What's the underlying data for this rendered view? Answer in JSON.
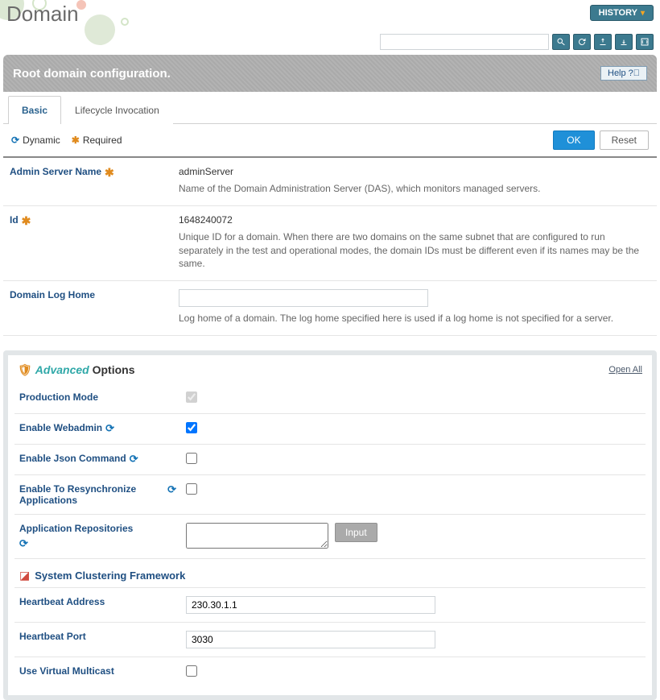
{
  "header": {
    "title": "Domain",
    "history_btn": "HISTORY",
    "search_placeholder": ""
  },
  "subtitle": "Root domain configuration.",
  "help_label": "Help",
  "tabs": {
    "basic": "Basic",
    "lifecycle": "Lifecycle Invocation"
  },
  "legend": {
    "dynamic": "Dynamic",
    "required": "Required"
  },
  "buttons": {
    "ok": "OK",
    "reset": "Reset",
    "input": "Input"
  },
  "rows": {
    "admin_server": {
      "label": "Admin Server Name",
      "value": "adminServer",
      "desc": "Name of the Domain Administration Server (DAS), which monitors managed servers."
    },
    "id": {
      "label": "Id",
      "value": "1648240072",
      "desc": "Unique ID for a domain. When there are two domains on the same subnet that are configured to run separately in the test and operational modes, the domain IDs must be different even if its names may be the same."
    },
    "log_home": {
      "label": "Domain Log Home",
      "value": "",
      "desc": "Log home of a domain. The log home specified here is used if a log home is not specified for a server."
    }
  },
  "advanced": {
    "title_prefix": "Advanced",
    "title_suffix": " Options",
    "open_all": "Open All",
    "production_mode": "Production Mode",
    "enable_webadmin": "Enable Webadmin",
    "enable_json": "Enable Json Command",
    "enable_resync": "Enable To Resynchronize Applications",
    "app_repos": "Application Repositories",
    "section_scf": "System Clustering Framework",
    "heartbeat_addr": {
      "label": "Heartbeat Address",
      "value": "230.30.1.1"
    },
    "heartbeat_port": {
      "label": "Heartbeat Port",
      "value": "3030"
    },
    "use_virtual_multicast": "Use Virtual Multicast"
  }
}
